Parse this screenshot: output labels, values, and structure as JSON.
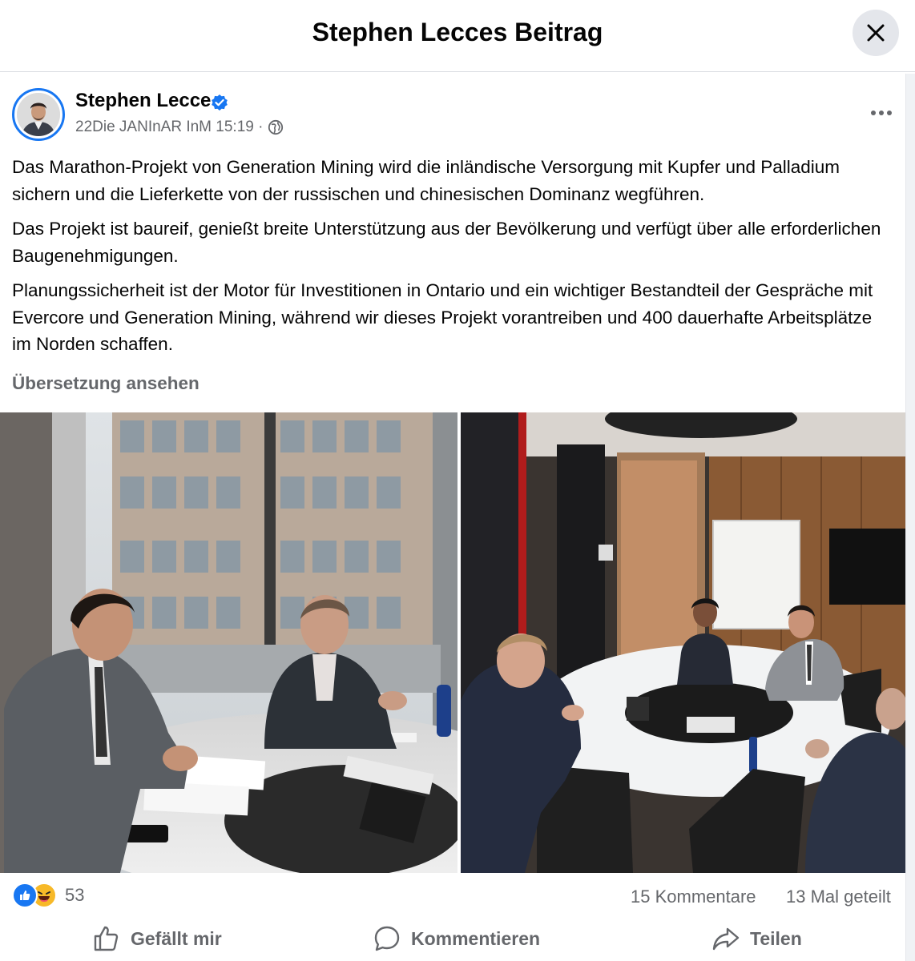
{
  "header": {
    "title": "Stephen Lecces Beitrag",
    "close_icon": "close-icon"
  },
  "post": {
    "author": "Stephen Lecce",
    "verified_icon": "verified-badge-icon",
    "meta": "22Die JANInAR InM 15:19 ·",
    "audience_icon": "globe-icon",
    "more_icon": "more-options-icon",
    "paragraphs": [
      "Das Marathon-Projekt von Generation Mining wird die inländische Versorgung mit Kupfer und Palladium sichern und die Lieferkette von der russischen und chinesischen Dominanz wegführen.",
      "Das Projekt ist baureif, genießt breite Unterstützung aus der Bevölkerung und verfügt über alle erforderlichen Baugenehmigungen.",
      "Planungssicherheit ist der Motor für Investitionen in Ontario und ein wichtiger Bestandteil der Gespräche mit Evercore und Generation Mining, während wir dieses Projekt vorantreiben und 400 dauerhafte Arbeitsplätze im Norden schaffen."
    ],
    "translate_link": "Übersetzung ansehen"
  },
  "stats": {
    "reaction_count": "53",
    "comments": "15 Kommentare",
    "shares": "13 Mal geteilt"
  },
  "actions": {
    "like": "Gefällt mir",
    "comment": "Kommentieren",
    "share": "Teilen"
  },
  "colors": {
    "brand_blue": "#1877f2",
    "secondary_text": "#65676b",
    "divider": "#dadde1"
  }
}
